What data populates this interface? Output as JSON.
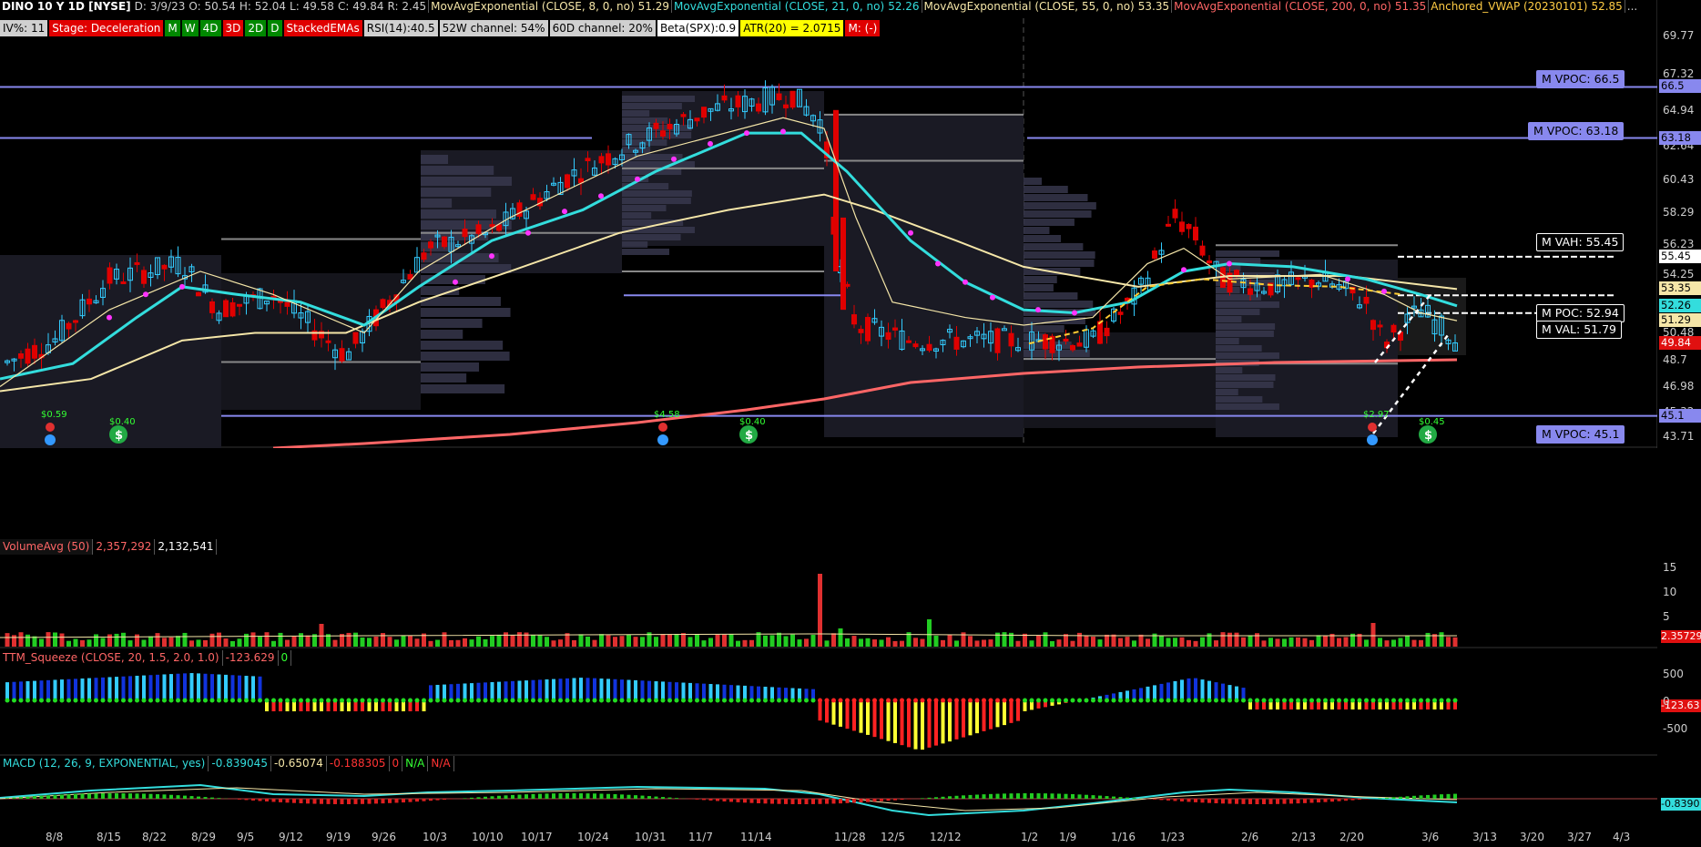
{
  "header": {
    "symbol": "DINO 10 Y 1D [NYSE]",
    "date": "D: 3/9/23",
    "open": "O: 50.54",
    "high": "H: 52.04",
    "low": "L: 49.58",
    "close": "C: 49.84",
    "range": "R: 2.45",
    "ema8_label": "MovAvgExponential (CLOSE, 8, 0, no)",
    "ema8_value": "51.29",
    "ema21_label": "MovAvgExponential (CLOSE, 21, 0, no)",
    "ema21_value": "52.26",
    "ema55_label": "MovAvgExponential (CLOSE, 55, 0, no)",
    "ema55_value": "53.35",
    "ema200_label": "MovAvgExponential (CLOSE, 200, 0, no)",
    "ema200_value": "51.35",
    "vwap_label": "Anchored_VWAP (20230101)",
    "vwap_value": "52.85",
    "more": "..."
  },
  "tags": [
    {
      "text": "IV%: 11",
      "bg": "#d0d0d0",
      "fg": "#000"
    },
    {
      "text": "Stage: Deceleration",
      "bg": "#e00000",
      "fg": "#fff"
    },
    {
      "text": "M",
      "bg": "#008800",
      "fg": "#fff"
    },
    {
      "text": "W",
      "bg": "#008800",
      "fg": "#fff"
    },
    {
      "text": "4D",
      "bg": "#008800",
      "fg": "#fff"
    },
    {
      "text": "3D",
      "bg": "#e00000",
      "fg": "#fff"
    },
    {
      "text": "2D",
      "bg": "#008800",
      "fg": "#fff"
    },
    {
      "text": "D",
      "bg": "#008800",
      "fg": "#fff"
    },
    {
      "text": "StackedEMAs",
      "bg": "#e00000",
      "fg": "#fff"
    },
    {
      "text": "RSI(14):40.5",
      "bg": "#d0d0d0",
      "fg": "#000"
    },
    {
      "text": "52W channel: 54%",
      "bg": "#d0d0d0",
      "fg": "#000"
    },
    {
      "text": "60D channel: 20%",
      "bg": "#d0d0d0",
      "fg": "#000"
    },
    {
      "text": "Beta(SPX):0.9",
      "bg": "#ffffff",
      "fg": "#000"
    },
    {
      "text": "ATR(20) = 2.0715",
      "bg": "#ffff00",
      "fg": "#000"
    },
    {
      "text": "M: (-)",
      "bg": "#e00000",
      "fg": "#fff"
    }
  ],
  "price_axis": [
    "69.77",
    "67.32",
    "64.94",
    "62.64",
    "60.43",
    "58.29",
    "56.23",
    "54.25",
    "52.33",
    "50.48",
    "48.7",
    "46.98",
    "45.32",
    "43.71"
  ],
  "price_labels": [
    {
      "text": "66.5",
      "color": "#8888ee",
      "fg": "#000",
      "y": 66.5
    },
    {
      "text": "63.18",
      "color": "#8888ee",
      "fg": "#000",
      "y": 63.18
    },
    {
      "text": "55.45",
      "color": "#ffffff",
      "fg": "#000",
      "y": 55.45
    },
    {
      "text": "53.35",
      "color": "#f5e6a8",
      "fg": "#000",
      "y": 53.35
    },
    {
      "text": "52.26",
      "color": "#33dddd",
      "fg": "#000",
      "y": 52.26
    },
    {
      "text": "51.29",
      "color": "#f5e6a8",
      "fg": "#000",
      "y": 51.29
    },
    {
      "text": "49.84",
      "color": "#e01010",
      "fg": "#fff",
      "y": 49.84
    },
    {
      "text": "45.1",
      "color": "#8888ee",
      "fg": "#000",
      "y": 45.1
    }
  ],
  "annotations": [
    {
      "text": "M VPOC: 66.5",
      "y": 66.5,
      "color": "#8888ee"
    },
    {
      "text": "M VPOC: 63.18",
      "y": 63.18,
      "color": "#8888ee"
    },
    {
      "text": "M VAH: 55.45",
      "y": 55.45,
      "color": "#ffffff"
    },
    {
      "text": "M POC: 52.94",
      "y": 52.94,
      "color": "#ffffff"
    },
    {
      "text": "M VAL: 51.79",
      "y": 51.79,
      "color": "#ffffff"
    },
    {
      "text": "M VPOC: 45.1",
      "y": 45.1,
      "color": "#8888ee"
    }
  ],
  "events": [
    "$0.59",
    "$0.40",
    "$4.58",
    "$0.40",
    "$2.97",
    "$0.45"
  ],
  "year_marker": "2023year",
  "volume": {
    "label": "VolumeAvg (50)",
    "value1": "2,357,292",
    "value2": "2,132,541",
    "axis": [
      "15",
      "10",
      "5"
    ],
    "last": "2.35729"
  },
  "squeeze": {
    "label": "TTM_Squeeze (CLOSE, 20, 1.5, 2.0, 1.0)",
    "value": "-123.629",
    "flag": "0",
    "axis": [
      "500",
      "0",
      "-500"
    ],
    "last": "-123.63"
  },
  "macd": {
    "label": "MACD (12, 26, 9, EXPONENTIAL, yes)",
    "v1": "-0.839045",
    "v2": "-0.65074",
    "v3": "-0.188305",
    "v4": "0",
    "v5": "N/A",
    "v6": "N/A",
    "last": "-0.8390"
  },
  "dates": [
    "8/8",
    "8/15",
    "8/22",
    "8/29",
    "9/5",
    "9/12",
    "9/19",
    "9/26",
    "10/3",
    "10/10",
    "10/17",
    "10/24",
    "10/31",
    "11/7",
    "11/14",
    "11/28",
    "12/5",
    "12/12",
    "1/2",
    "1/9",
    "1/16",
    "1/23",
    "2/6",
    "2/13",
    "2/20",
    "3/6",
    "3/13",
    "3/20",
    "3/27",
    "4/3"
  ],
  "colors": {
    "up": "#33ccff",
    "down": "#e00000",
    "ema8": "#f5e6a8",
    "ema21": "#33dddd",
    "ema55": "#f5e6a8",
    "ema200": "#ff6666",
    "vpoc": "#8888ee"
  }
}
